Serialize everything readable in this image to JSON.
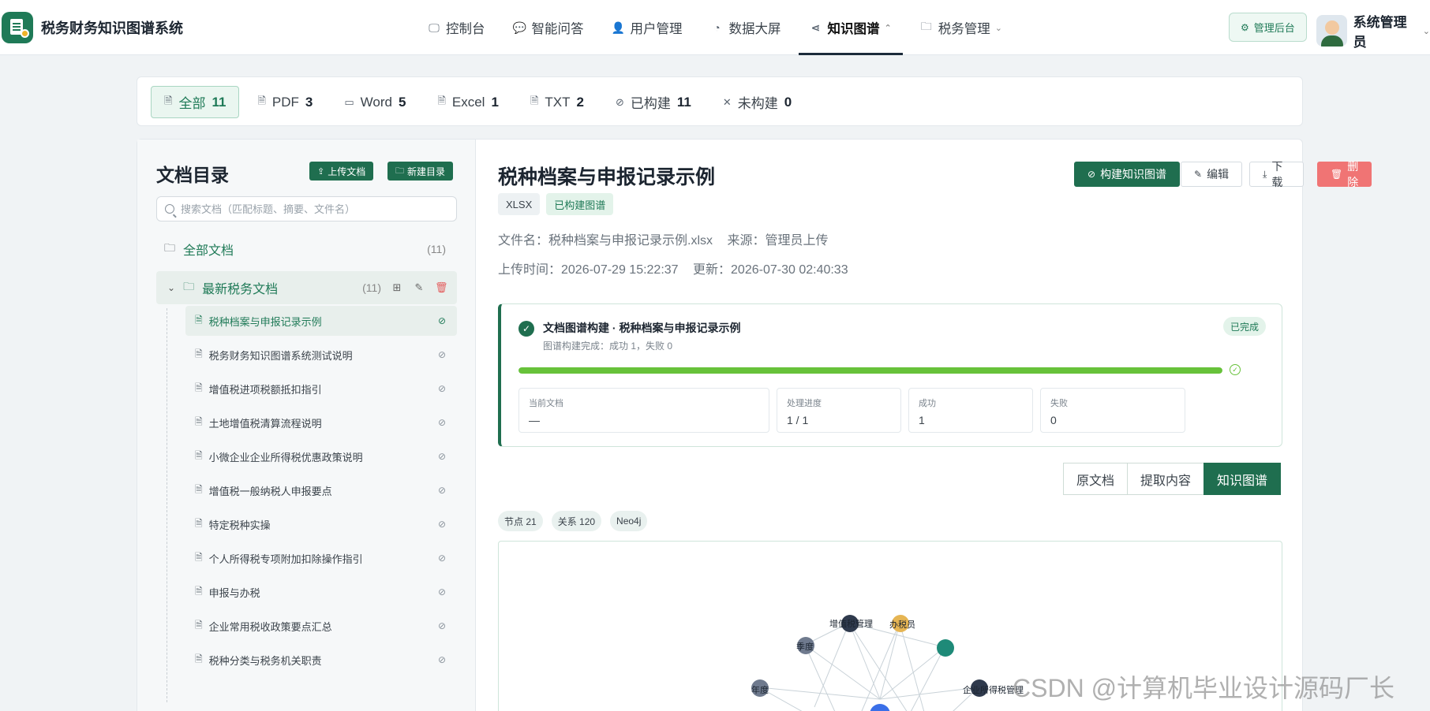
{
  "app": {
    "title": "税务财务知识图谱系统"
  },
  "nav": {
    "items": [
      {
        "label": "控制台",
        "icon": "monitor-icon"
      },
      {
        "label": "智能问答",
        "icon": "chat-icon"
      },
      {
        "label": "用户管理",
        "icon": "user-icon"
      },
      {
        "label": "数据大屏",
        "icon": "pie-chart-icon"
      },
      {
        "label": "知识图谱",
        "icon": "share-icon",
        "active": true
      },
      {
        "label": "税务管理",
        "icon": "folder-icon"
      }
    ],
    "admin_label": "管理后台",
    "user_name": "系统管理员"
  },
  "filters": [
    {
      "label": "全部",
      "count": "11",
      "active": true
    },
    {
      "label": "PDF",
      "count": "3"
    },
    {
      "label": "Word",
      "count": "5"
    },
    {
      "label": "Excel",
      "count": "1"
    },
    {
      "label": "TXT",
      "count": "2"
    },
    {
      "label": "已构建",
      "count": "11"
    },
    {
      "label": "未构建",
      "count": "0"
    }
  ],
  "sidebar": {
    "title": "文档目录",
    "upload_label": "上传文档",
    "new_folder_label": "新建目录",
    "search_placeholder": "搜索文档（匹配标题、摘要、文件名）",
    "root": {
      "label": "全部文档",
      "count": "(11)"
    },
    "folder": {
      "label": "最新税务文档",
      "count": "(11)"
    },
    "docs": [
      "税种档案与申报记录示例",
      "税务财务知识图谱系统测试说明",
      "增值税进项税额抵扣指引",
      "土地增值税清算流程说明",
      "小微企业企业所得税优惠政策说明",
      "增值税一般纳税人申报要点",
      "特定税种实操",
      "个人所得税专项附加扣除操作指引",
      "申报与办税",
      "企业常用税收政策要点汇总",
      "税种分类与税务机关职责"
    ]
  },
  "document": {
    "title": "税种档案与申报记录示例",
    "tag_type": "XLSX",
    "tag_status": "已构建图谱",
    "filename": "文件名：税种档案与申报记录示例.xlsx",
    "source": "来源：管理员上传",
    "upload_time": "上传时间：2026-07-29 15:22:37",
    "update_time": "更新：2026-07-30 02:40:33",
    "buttons": {
      "build": "构建知识图谱",
      "edit": "编辑",
      "download": "下载",
      "delete": "删除"
    }
  },
  "progress": {
    "title": "文档图谱构建 · 税种档案与申报记录示例",
    "subtitle": "图谱构建完成：成功 1，失败 0",
    "status": "已完成",
    "percent": 100,
    "stats": [
      {
        "label": "当前文档",
        "value": "—"
      },
      {
        "label": "处理进度",
        "value": "1 / 1"
      },
      {
        "label": "成功",
        "value": "1"
      },
      {
        "label": "失败",
        "value": "0"
      }
    ]
  },
  "view_tabs": [
    {
      "label": "原文档"
    },
    {
      "label": "提取内容"
    },
    {
      "label": "知识图谱",
      "active": true
    }
  ],
  "graph": {
    "tags": [
      "节点 21",
      "关系 120",
      "Neo4j"
    ],
    "node_labels": [
      "增值税管理",
      "办税员",
      "季度",
      "年度",
      "企业所得税管理"
    ]
  },
  "colors": {
    "primary": "#1f6e4f",
    "success": "#67c23a",
    "danger": "#f07474"
  },
  "watermark": "CSDN @计算机毕业设计源码厂长"
}
